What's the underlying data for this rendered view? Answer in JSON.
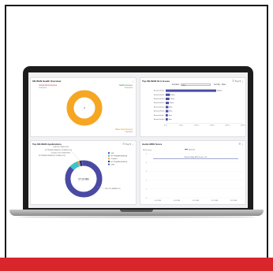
{
  "colors": {
    "red_bar": "#d9262b",
    "amber": "#f5a623",
    "critical": "#e53935",
    "indigo": "#4a4aa3",
    "teal": "#3ec3c7",
    "orange": "#ff9c33",
    "navy": "#2a2a6b",
    "blue": "#2f6bd8"
  },
  "panels": {
    "health": {
      "title": "SD-WAN Health Overview",
      "critical_label": "Critical Alerts Devices",
      "critical_sub": "0 devices",
      "healthy_label": "Healthy Devices",
      "healthy_sub": "0 devices",
      "major_label": "Major Alerts Devices",
      "major_sub": "7 devices",
      "center": "7"
    },
    "isp": {
      "title": "Top SD-WAN SLA Issues",
      "controls": "☰ Top 5 ⋮",
      "filter_label": "Interface",
      "filter_value": "ALL",
      "filter_right": "Sort By : Most",
      "rows": [
        {
          "label": "Branch-Hub-1",
          "value": 95,
          "text": "150ms"
        },
        {
          "label": "Branch-Hub-2",
          "value": 8,
          "text": "15ms"
        },
        {
          "label": "Branch-Hub-3",
          "value": 7,
          "text": "12ms"
        },
        {
          "label": "Branch-Hub-4",
          "value": 6,
          "text": "10ms"
        },
        {
          "label": "Branch-Hub-5",
          "value": 5,
          "text": "8ms"
        },
        {
          "label": "Branch-Hub-6",
          "value": 5,
          "text": "8ms"
        },
        {
          "label": "Branch-Hub-7",
          "value": 4,
          "text": "6ms"
        },
        {
          "label": "Branch-Hub-8",
          "value": 4,
          "text": "6ms"
        }
      ],
      "xticks": [
        "0ms",
        "50ms",
        "100ms",
        "150ms",
        "200ms",
        "250ms"
      ]
    },
    "apps": {
      "title": "Top SD-WAN Applications",
      "controls": "☰ Top 5 ⋮",
      "center": "27.8 MB",
      "callouts": [
        "DNS 28.3 KB(0.10%)",
        "HTTPS(BROWSING) 2.8 MB(10.1%)",
        "Dropbox 190.5 KB(0.68%)",
        "HTTPS(BROWSING) 3.9 MB(14.0%)",
        "SSL 24.5 MB(88.0%)"
      ],
      "legend": [
        {
          "label": "SSL",
          "color": "#4a4aa3"
        },
        {
          "label": "HTTPS(BROWSING)",
          "color": "#3ec3c7"
        },
        {
          "label": "Dropbox",
          "color": "#ff9c33"
        },
        {
          "label": "HTTPS(BROWSING)",
          "color": "#2a2a6b"
        },
        {
          "label": "DNS",
          "color": "#2f6bd8"
        }
      ]
    },
    "mos": {
      "title": "Audio MOS Score",
      "controls": "☰ ⋮",
      "unit_label": "MOS Score",
      "legend": "Branch1",
      "series_label": "Branch1 Avg MOS Score: 4.4",
      "yticks": [
        "5",
        "4",
        "3",
        "2",
        "1",
        "0"
      ],
      "xticks": [
        "09:00 AM",
        "09:05 AM",
        "09:10 AM",
        "09:15 AM",
        "09:20 AM"
      ]
    }
  }
}
